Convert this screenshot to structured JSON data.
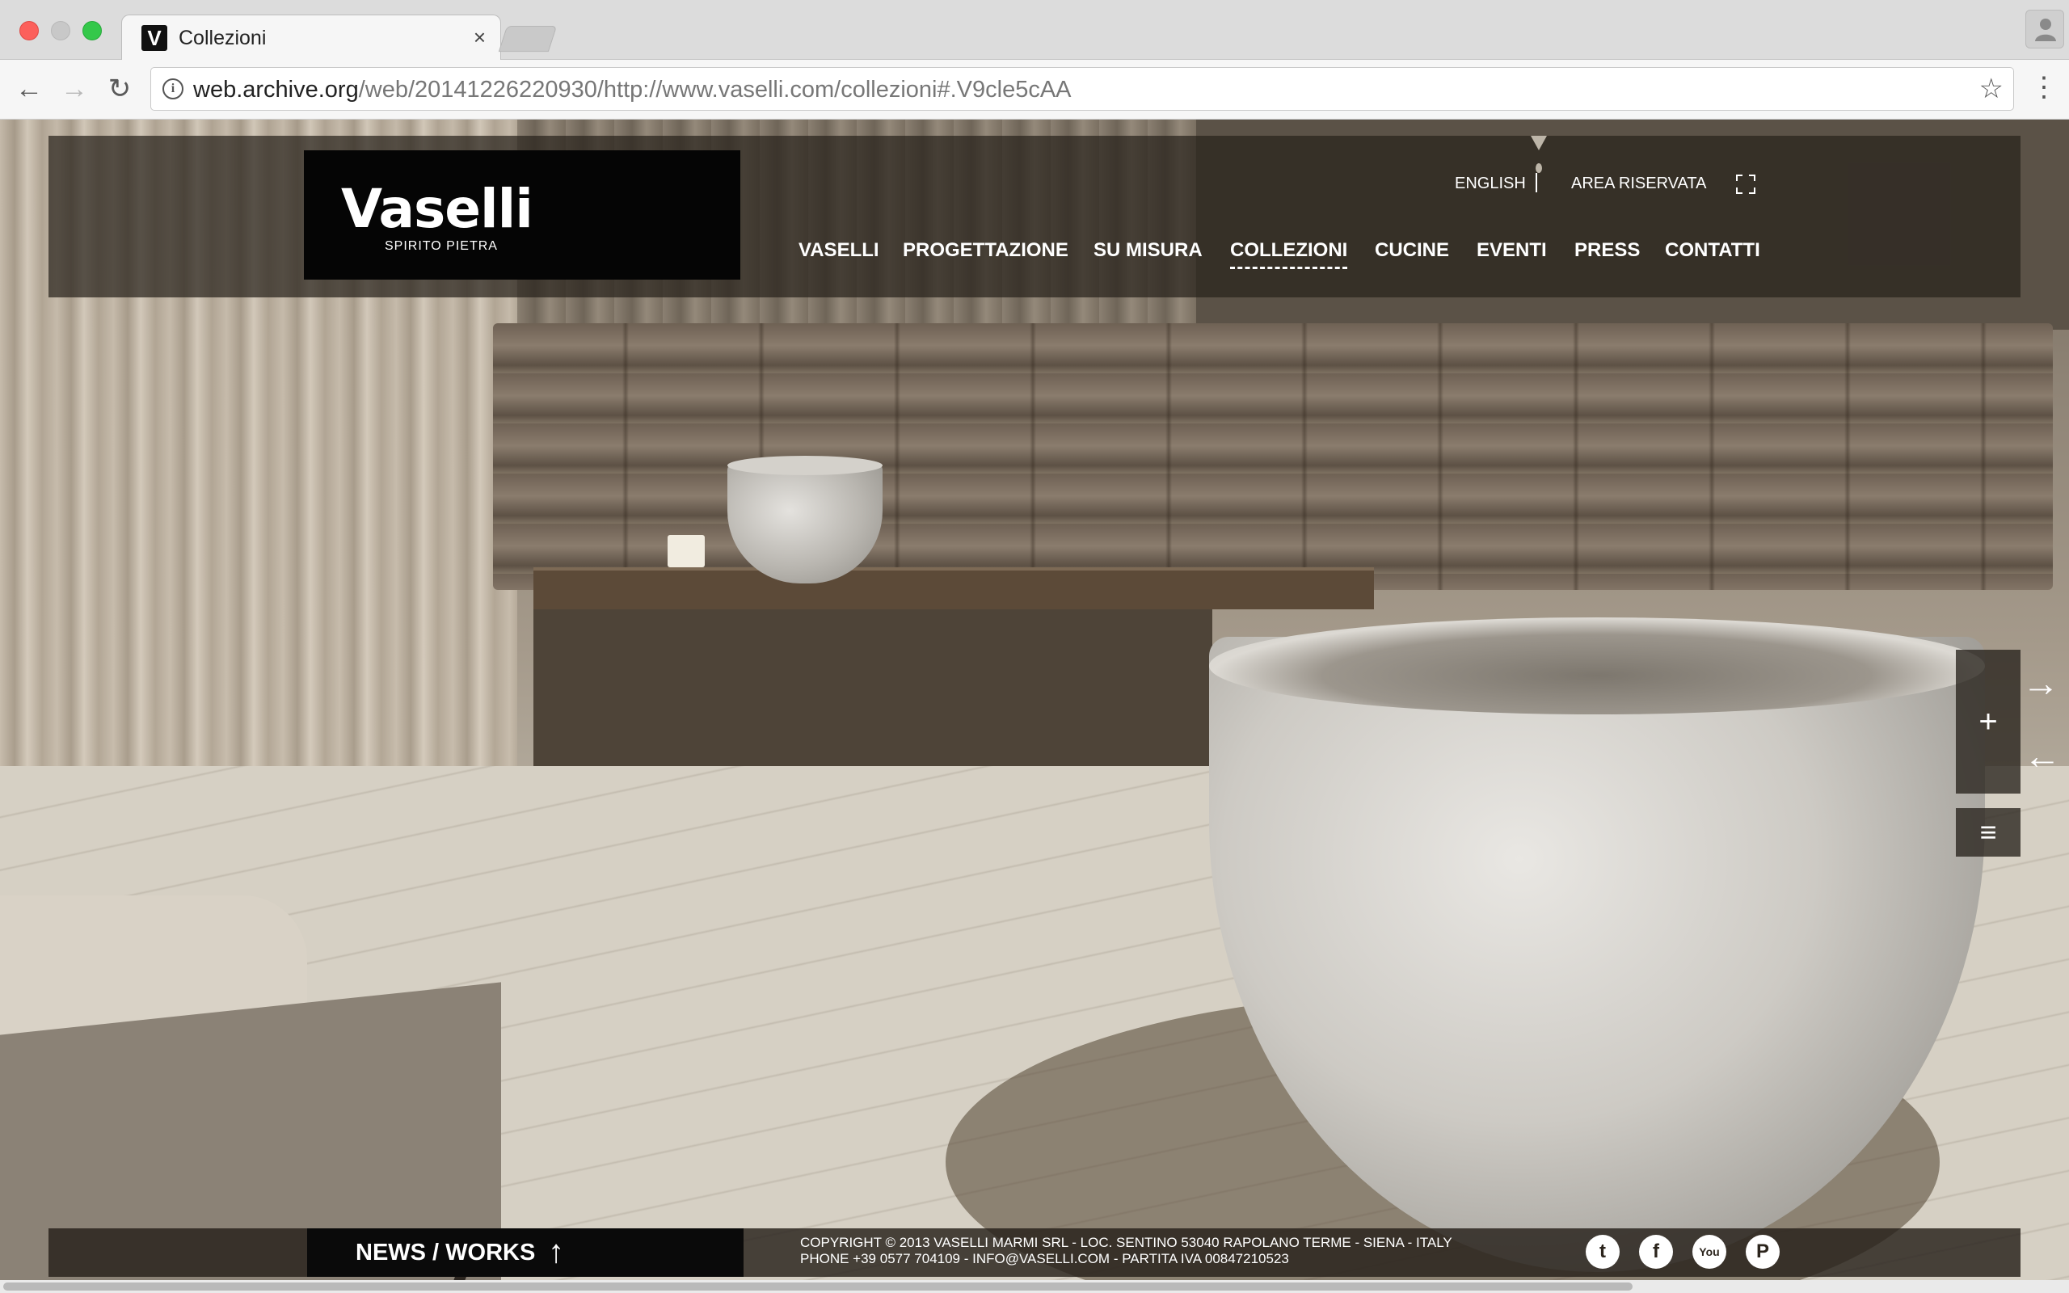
{
  "browser": {
    "tab_title": "Collezioni",
    "tab_favicon": "V",
    "tab_close": "×",
    "url_host": "web.archive.org",
    "url_path": "/web/20141226220930/http://www.vaselli.com/collezioni#.V9cle5cAA",
    "icons": [
      "back-arrow-icon",
      "forward-arrow-icon",
      "reload-icon",
      "info-icon",
      "star-icon",
      "menu-dots-icon",
      "profile-icon"
    ]
  },
  "site": {
    "logo_word": "Vaselli",
    "logo_tagline": "SPIRITO PIETRA",
    "top_links": {
      "english": "ENGLISH",
      "area": "AREA RISERVATA"
    },
    "nav": [
      {
        "label": "VASELLI",
        "active": false
      },
      {
        "label": "PROGETTAZIONE",
        "active": false
      },
      {
        "label": "SU MISURA",
        "active": false
      },
      {
        "label": "COLLEZIONI",
        "active": true
      },
      {
        "label": "CUCINE",
        "active": false
      },
      {
        "label": "EVENTI",
        "active": false
      },
      {
        "label": "PRESS",
        "active": false
      },
      {
        "label": "CONTATTI",
        "active": false
      }
    ],
    "side_controls": {
      "plus": "+",
      "menu": "≡",
      "next": "→",
      "prev": "←"
    },
    "footer": {
      "news_label": "NEWS / WORKS",
      "news_arrow": "↑",
      "copyright_line1": "COPYRIGHT © 2013 VASELLI MARMI SRL - LOC. SENTINO 53040 RAPOLANO TERME - SIENA - ITALY",
      "copyright_line2": "PHONE +39 0577 704109 - INFO@VASELLI.COM - PARTITA IVA 00847210523",
      "social": [
        {
          "name": "twitter-icon",
          "glyph": "t"
        },
        {
          "name": "facebook-icon",
          "glyph": "f"
        },
        {
          "name": "youtube-icon",
          "glyph": "You"
        },
        {
          "name": "pinterest-icon",
          "glyph": "P"
        }
      ]
    },
    "colors": {
      "header_overlay": "#28221c",
      "logo_bg": "#050505",
      "text": "#ffffff"
    }
  }
}
